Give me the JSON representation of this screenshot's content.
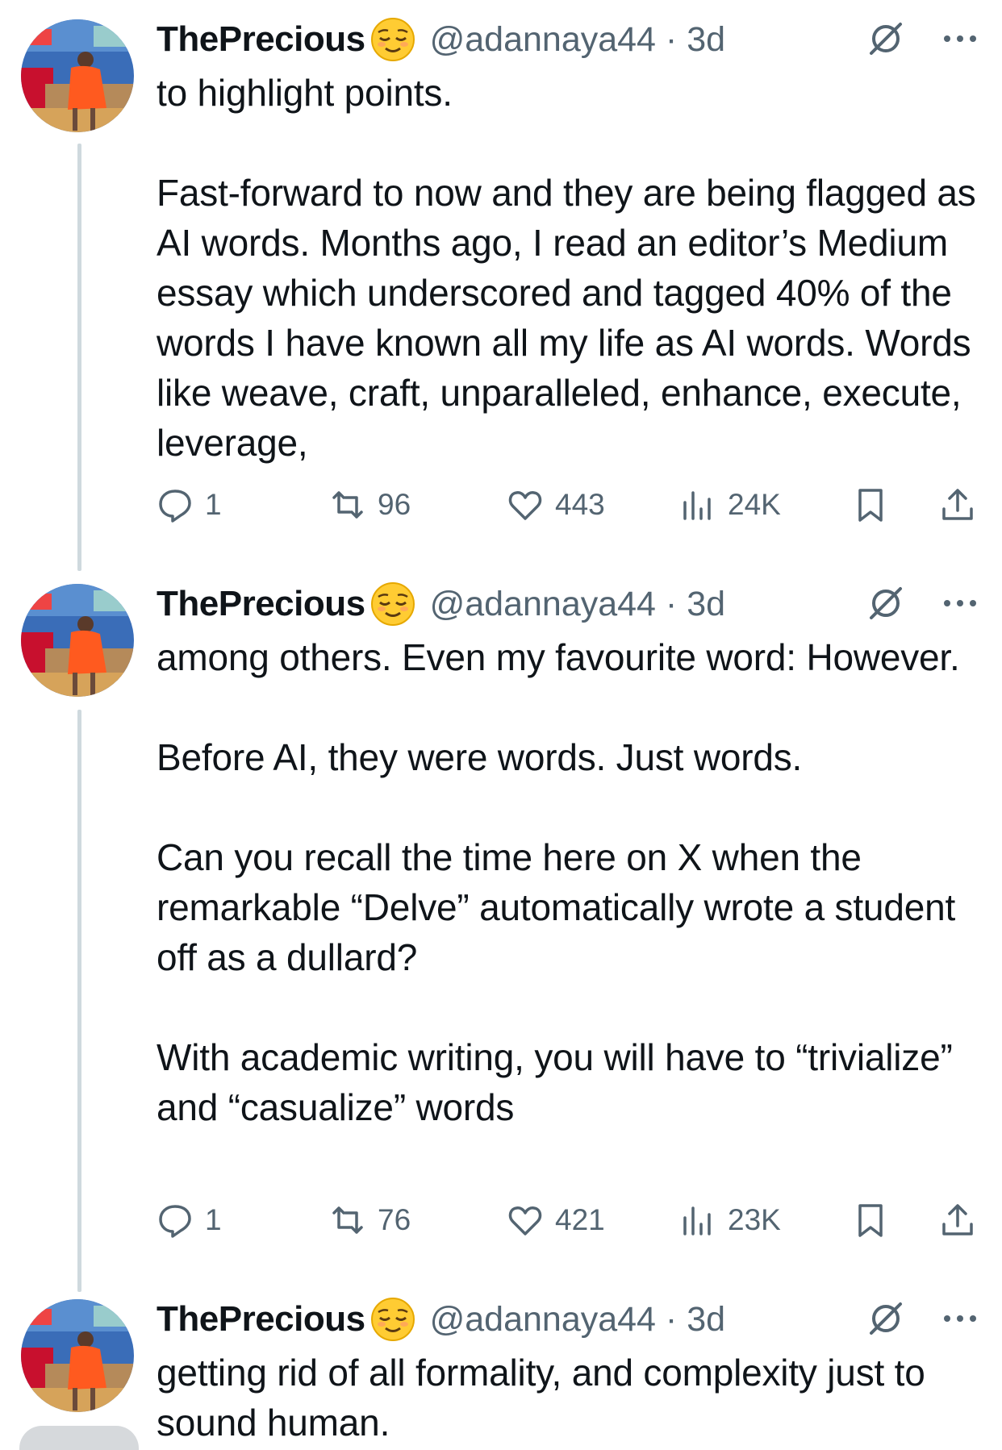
{
  "tweets": [
    {
      "name": "ThePrecious",
      "handle": "@adannaya44",
      "time": "3d",
      "body": "to highlight points.\n\nFast-forward to now and they are being flagged as AI words. Months ago, I read an editor’s Medium essay which underscored and tagged 40% of the words I have known all my life as AI words. Words like weave, craft, unparalleled, enhance, execute, leverage,",
      "stats": {
        "replies": "1",
        "reposts": "96",
        "likes": "443",
        "views": "24K"
      }
    },
    {
      "name": "ThePrecious",
      "handle": "@adannaya44",
      "time": "3d",
      "body": "among others. Even my favourite word: However.\n\nBefore AI, they were words. Just words.\n\nCan you recall the time here on X when the remarkable “Delve” automatically wrote a student off as a dullard?\n\nWith academic writing, you will have to “trivialize” and “casualize” words",
      "stats": {
        "replies": "1",
        "reposts": "76",
        "likes": "421",
        "views": "23K"
      }
    },
    {
      "name": "ThePrecious",
      "handle": "@adannaya44",
      "time": "3d",
      "body": "getting rid of all formality, and complexity just to sound human.",
      "stats": null
    }
  ],
  "icons": {
    "emoji": "relieved-face-emoji",
    "grok": "grok-icon",
    "more": "more-options-icon",
    "reply": "reply-icon",
    "repost": "repost-icon",
    "like": "heart-icon",
    "views": "views-icon",
    "bookmark": "bookmark-icon",
    "share": "share-icon"
  },
  "colors": {
    "text": "#0f1419",
    "secondary": "#536471",
    "thread": "#cfd9de"
  }
}
